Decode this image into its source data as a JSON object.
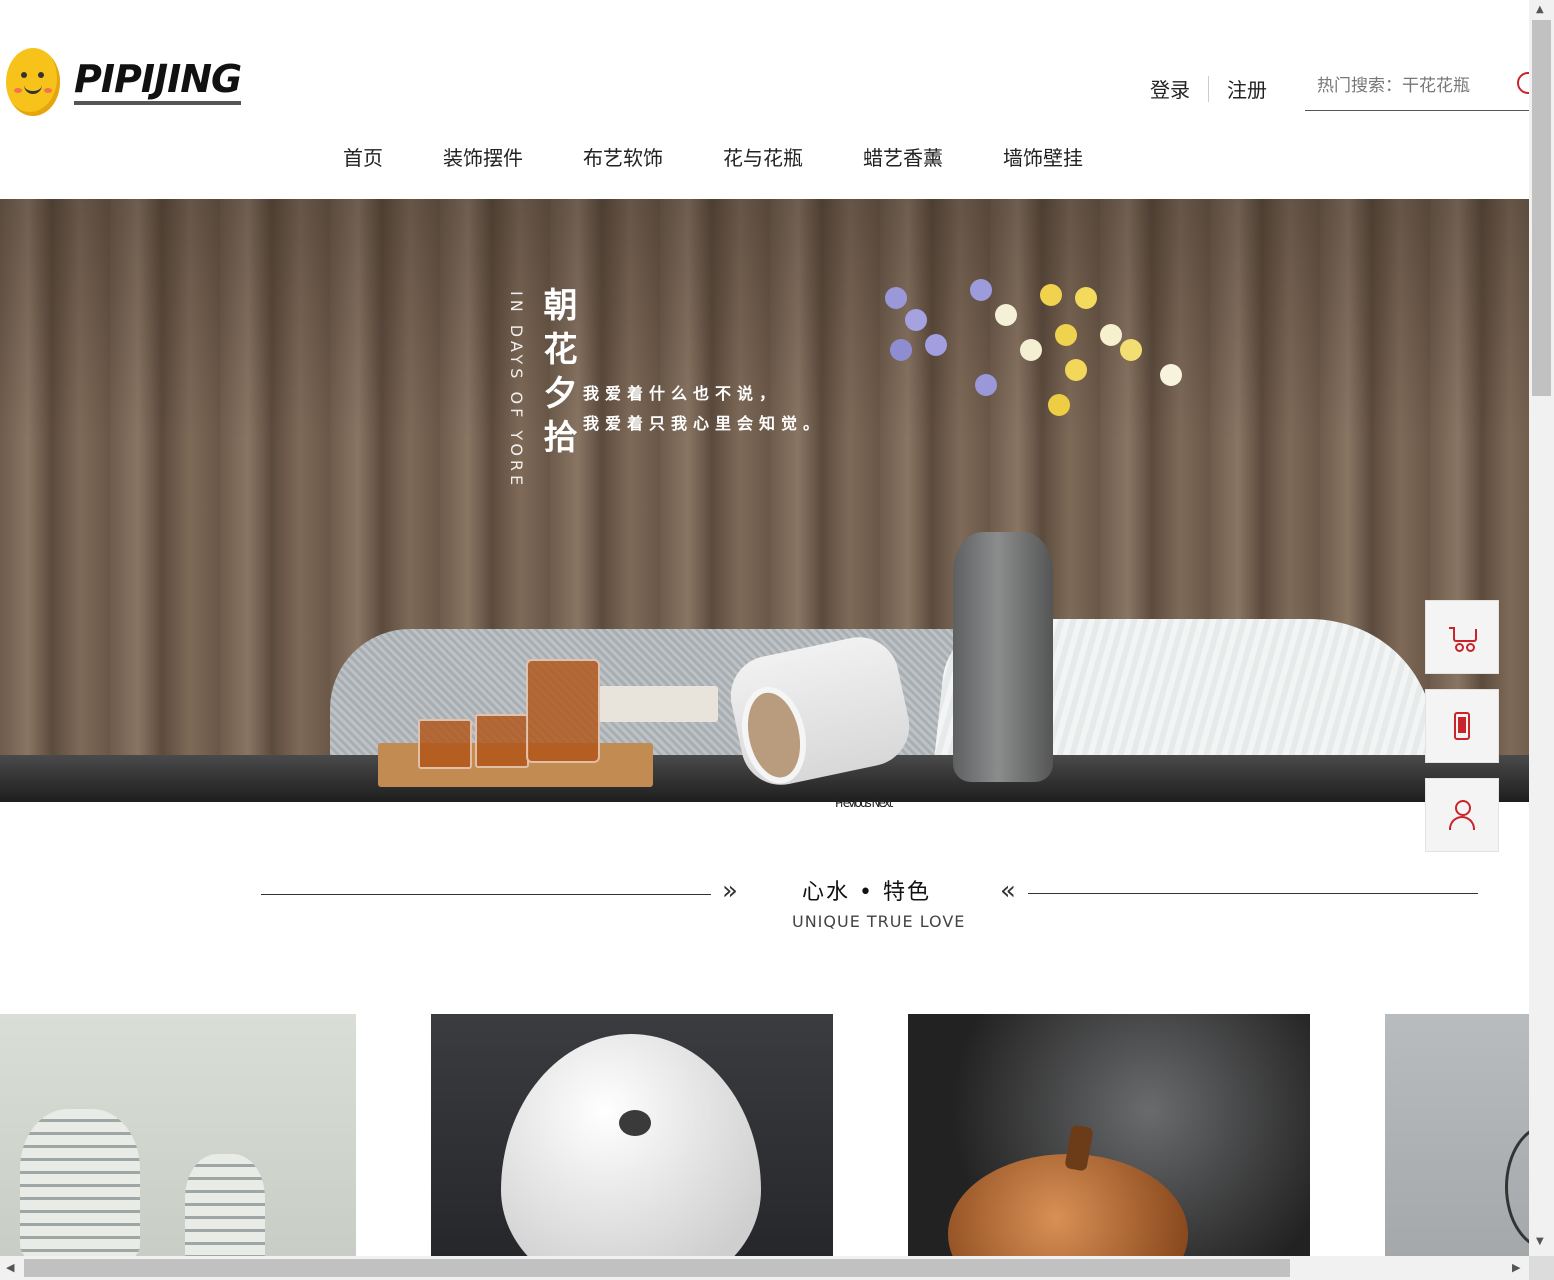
{
  "brand": {
    "name": "PIPIJING"
  },
  "auth": {
    "login": "登录",
    "register": "注册"
  },
  "search": {
    "placeholder": "热门搜索：干花花瓶"
  },
  "nav": [
    "首页",
    "装饰摆件",
    "布艺软饰",
    "花与花瓶",
    "蜡艺香薰",
    "墙饰壁挂"
  ],
  "hero": {
    "title": "朝花夕拾",
    "title_en": "IN DAYS OF YORE",
    "lines": [
      "我爱着什么也不说，",
      "我爱着只我心里会知觉。"
    ],
    "caption": "Previous Next"
  },
  "float_bar": {
    "icons": [
      "cart-icon",
      "phone-icon",
      "user-icon"
    ],
    "accent": "#c8242c"
  },
  "section": {
    "title": "心水 • 特色",
    "subtitle": "UNIQUE TRUE LOVE",
    "chev_left": "»",
    "chev_right": "«"
  },
  "scrollbars": {
    "up": "▲",
    "down": "▼",
    "left": "◀",
    "right": "▶"
  }
}
